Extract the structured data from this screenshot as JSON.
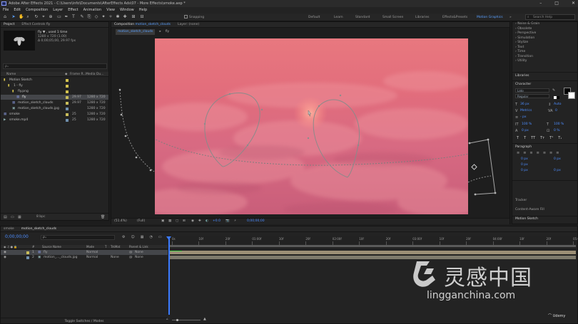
{
  "title": "Adobe After Effects 2021 - C:\\Users\\info\\Documents\\AfterEffects Ads\\07 - More Effects\\smoke.aep *",
  "menu": [
    "File",
    "Edit",
    "Composition",
    "Layer",
    "Effect",
    "Animation",
    "View",
    "Window",
    "Help"
  ],
  "toolbar": {
    "snapping": "Snapping",
    "workspaces": [
      "Default",
      "Learn",
      "Standard",
      "Small Screen",
      "Libraries",
      "Effects&Presets",
      "Motion Graphics Templates"
    ],
    "active_workspace": "Motion Graphics Templates",
    "search_placeholder": "Search Help"
  },
  "project": {
    "tabs": [
      "Project",
      "Effect Controls fly"
    ],
    "footage_name": "fly ▼ , used 1 time",
    "footage_dims": "1280 x 720 (1.00)",
    "footage_info": "Δ 0;00;05;00, 29.97 fps",
    "search": "ρ₊",
    "columns": [
      "Name",
      "",
      "Frame R...",
      "Media Du..."
    ],
    "items": [
      {
        "name": "Motion Sketch",
        "type": "folder",
        "indent": 0,
        "fps": "",
        "dims": ""
      },
      {
        "name": "1 - fly",
        "type": "folder",
        "indent": 1,
        "fps": "",
        "dims": ""
      },
      {
        "name": "fly.png",
        "type": "folder",
        "indent": 2,
        "fps": "",
        "dims": ""
      },
      {
        "name": "fly",
        "type": "comp",
        "indent": 3,
        "fps": "29.97",
        "dims": "1280 x 720",
        "selected": true
      },
      {
        "name": "motion_sketch_clouds",
        "type": "comp",
        "indent": 2,
        "fps": "29.97",
        "dims": "1280 x 720"
      },
      {
        "name": "motion_sketch_clouds.jpg",
        "type": "image",
        "indent": 2,
        "fps": "",
        "dims": "1280 x 720"
      },
      {
        "name": "smoke",
        "type": "comp",
        "indent": 0,
        "fps": "25",
        "dims": "1280 x 720"
      },
      {
        "name": "smoke.mp4",
        "type": "video",
        "indent": 0,
        "fps": "25",
        "dims": "1280 x 720"
      }
    ],
    "bpc": "8 bpc"
  },
  "composition": {
    "tab_label": "Composition",
    "comp_name": "motion_sketch_clouds",
    "layer_tab": "Layer: (none)",
    "breadcrumb": "motion_sketch_clouds",
    "breadcrumb2": "fly",
    "zoom": "(51.4%)",
    "quality": "(Full)",
    "timecode": "0;00;00;00",
    "exposure": "+0.0"
  },
  "right_panel": {
    "effects": [
      "Noise & Grain",
      "Obsolete",
      "Perspective",
      "Simulation",
      "Stylize",
      "Text",
      "Time",
      "Transition",
      "Utility"
    ],
    "libraries": "Libraries",
    "character": "Character",
    "font": "Lato",
    "font_style": "Regular",
    "size": "36 px",
    "leading": "Auto",
    "tracking": "0",
    "kerning": "Metrics",
    "vscale": "100 %",
    "hscale": "100 %",
    "baseline": "0 px",
    "tsume": "0 %",
    "px": "- px",
    "paragraph": "Paragraph",
    "indent_vals": [
      "0 px",
      "0 px",
      "0 px",
      "0 px",
      "0 px"
    ],
    "tracker": "Tracker",
    "content_aware": "Content-Aware Fill",
    "motion_sketch": "Motion Sketch"
  },
  "timeline": {
    "tabs": [
      "smoke",
      "motion_sketch_clouds"
    ],
    "timecode": "0;00;00;00",
    "col_headers": [
      "#",
      "Source Name",
      "Mode",
      "T",
      "TrkMat",
      "Parent & Link"
    ],
    "layers": [
      {
        "num": "1",
        "name": "fly",
        "mode": "Normal",
        "trkmat": "",
        "parent": "None"
      },
      {
        "num": "2",
        "name": "motion_..._clouds.jpg",
        "mode": "Normal",
        "trkmat": "None",
        "parent": "None"
      }
    ],
    "ruler": [
      "0s",
      "10f",
      "20f",
      "01:00f",
      "10f",
      "20f",
      "02:00f",
      "10f",
      "20f",
      "03:00f",
      "10f",
      "20f",
      "04:00f",
      "10f",
      "20f",
      "05:0"
    ],
    "footer": "Toggle Switches / Modes"
  },
  "watermark": {
    "cn": "灵感中国",
    "url": "lingganchina.com",
    "udemy": "Udemy"
  }
}
